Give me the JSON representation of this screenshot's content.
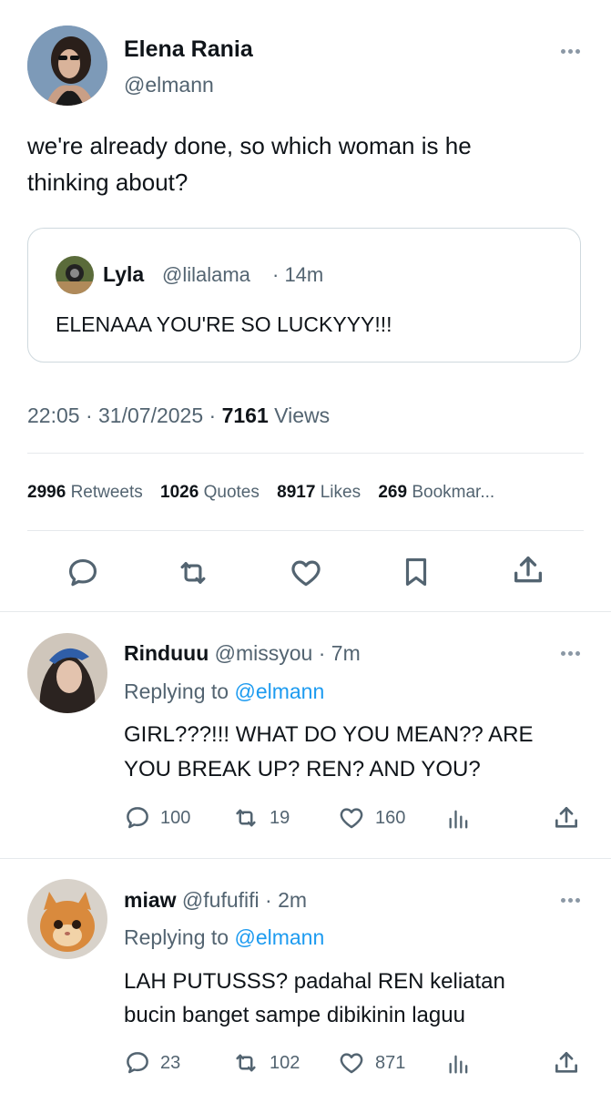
{
  "tweet": {
    "author_name": "Elena Rania",
    "author_handle": "@elmann",
    "text_line1": "we're already done, so which woman is he",
    "text_line2": "thinking about?",
    "quote": {
      "name": "Lyla",
      "handle": "@lilalama",
      "time": "· 14m",
      "text": "ELENAAA YOU'RE SO LUCKYYY!!!"
    },
    "time": "22:05",
    "sep1": "·",
    "date": "31/07/2025",
    "sep2": "·",
    "views_count": "7161",
    "views_label": "Views",
    "stats": [
      {
        "count": "2996",
        "label": "Retweets"
      },
      {
        "count": "1026",
        "label": "Quotes"
      },
      {
        "count": "8917",
        "label": "Likes"
      },
      {
        "count": "269",
        "label": "Bookmar..."
      }
    ]
  },
  "replies": [
    {
      "name": "Rinduuu",
      "handle": "@missyou",
      "time": "· 7m",
      "replying_prefix": "Replying to",
      "replying_to": "@elmann",
      "line1": "GIRL???!!! WHAT DO YOU MEAN?? ARE",
      "line2": "YOU BREAK UP? REN? AND YOU?",
      "comments": "100",
      "retweets": "19",
      "likes": "160"
    },
    {
      "name": "miaw",
      "handle": "@fufufifi",
      "time": "· 2m",
      "replying_prefix": "Replying to",
      "replying_to": "@elmann",
      "line1": "LAH PUTUSSS? padahal REN keliatan",
      "line2": "bucin banget sampe dibikinin laguu",
      "comments": "23",
      "retweets": "102",
      "likes": "871"
    }
  ],
  "colors": {
    "link": "#1d9bf0",
    "muted": "#536471",
    "text": "#0f1419"
  }
}
